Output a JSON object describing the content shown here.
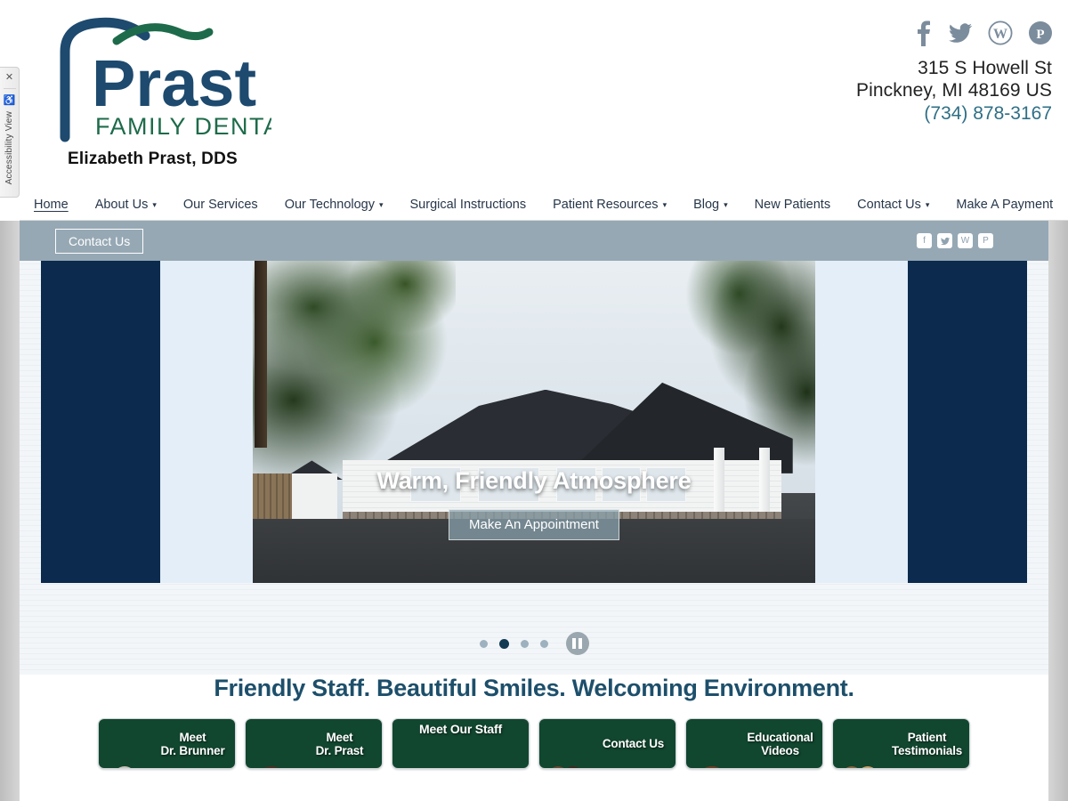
{
  "site": {
    "logo_primary": "Prast",
    "logo_secondary": "FAMILY DENTAL",
    "doctor_name": "Elizabeth Prast, DDS"
  },
  "colors": {
    "navy": "#0b2a4d",
    "teal_text": "#2f6f86",
    "heading": "#1d4f6b",
    "card_green": "#11462f",
    "subbar": "#96a8b4",
    "social_gray": "#7b8c9c",
    "light_panel": "#e3eef8"
  },
  "accessibility": {
    "close_icon": "close-icon",
    "wheelchair_icon": "wheelchair-icon",
    "label": "Accessibility View",
    "close_glyph": "✕",
    "wheel_glyph": "♿"
  },
  "header": {
    "social": [
      {
        "name": "facebook-icon",
        "glyph": "f"
      },
      {
        "name": "twitter-icon",
        "glyph": "🐦"
      },
      {
        "name": "wordpress-icon",
        "glyph": "W"
      },
      {
        "name": "pinterest-icon",
        "glyph": "P"
      }
    ],
    "address_line1": "315 S Howell St",
    "address_line2": "Pinckney, MI 48169 US",
    "phone": "(734) 878-3167"
  },
  "nav": {
    "items": [
      {
        "label": "Home",
        "has_caret": false,
        "active": true
      },
      {
        "label": "About Us",
        "has_caret": true,
        "active": false
      },
      {
        "label": "Our Services",
        "has_caret": false,
        "active": false
      },
      {
        "label": "Our Technology",
        "has_caret": true,
        "active": false
      },
      {
        "label": "Surgical Instructions",
        "has_caret": false,
        "active": false
      },
      {
        "label": "Patient Resources",
        "has_caret": true,
        "active": false
      },
      {
        "label": "Blog",
        "has_caret": true,
        "active": false
      },
      {
        "label": "New Patients",
        "has_caret": false,
        "active": false
      },
      {
        "label": "Contact Us",
        "has_caret": true,
        "active": false
      },
      {
        "label": "Make A Payment",
        "has_caret": false,
        "active": false
      }
    ],
    "caret_glyph": "▾"
  },
  "subbar": {
    "contact_button": "Contact Us",
    "social": [
      {
        "name": "facebook-icon",
        "glyph": "f"
      },
      {
        "name": "twitter-icon",
        "glyph": "🐦"
      },
      {
        "name": "wordpress-icon",
        "glyph": "W"
      },
      {
        "name": "pinterest-icon",
        "glyph": "P"
      }
    ]
  },
  "slider": {
    "caption_title": "Warm, Friendly Atmosphere",
    "cta_label": "Make An Appointment",
    "dots": [
      {
        "active": false
      },
      {
        "active": true
      },
      {
        "active": false
      },
      {
        "active": false
      }
    ],
    "pause_label": "pause-button"
  },
  "promo": {
    "headline": "Friendly Staff. Beautiful Smiles. Welcoming Environment.",
    "cards": [
      {
        "label_line1": "Meet",
        "label_line2": "Dr. Brunner",
        "layout": "side",
        "skin": "#e9c4a3",
        "hair": "#c9c3bb",
        "shirt": "#bcd6ee"
      },
      {
        "label_line1": "Meet",
        "label_line2": "Dr. Prast",
        "layout": "side",
        "skin": "#efcaa8",
        "hair": "#4a3224",
        "shirt": "#f2f2f2"
      },
      {
        "label_line1": "Meet Our Staff",
        "label_line2": "",
        "layout": "team",
        "skin": "#e8c3a0",
        "hair": "#3a2a20",
        "shirt": "#2f9fc4"
      },
      {
        "label_line1": "Contact Us",
        "label_line2": "",
        "layout": "side",
        "skin": "#f0c9a4",
        "hair": "#6b4a32",
        "shirt": "#f6f1e8"
      },
      {
        "label_line1": "Educational",
        "label_line2": "Videos",
        "layout": "side",
        "skin": "#f3cfac",
        "hair": "#6d3f26",
        "shirt": "#e8d6c4"
      },
      {
        "label_line1": "Patient",
        "label_line2": "Testimonials",
        "layout": "side",
        "skin": "#f2cfa9",
        "hair": "#caa36c",
        "shirt": "#f2ece2"
      }
    ]
  }
}
